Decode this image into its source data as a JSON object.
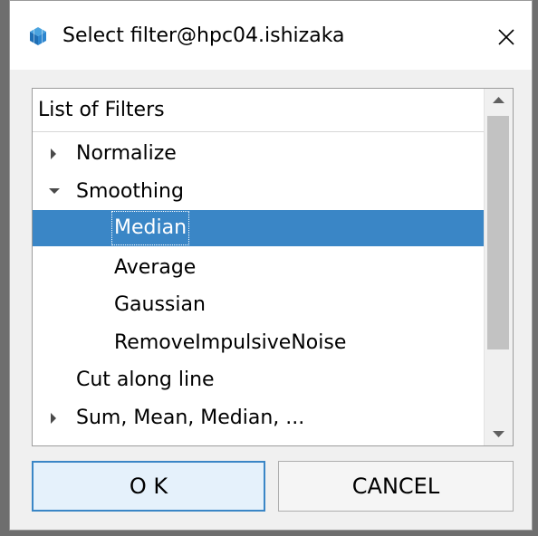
{
  "window": {
    "title": "Select filter@hpc04.ishizaka",
    "app_icon": "cube-icon",
    "close_icon": "close-icon"
  },
  "list": {
    "header": "List of Filters",
    "items": [
      {
        "label": "Normalize",
        "expander": "collapsed"
      },
      {
        "label": "Smoothing",
        "expander": "expanded"
      },
      {
        "label": "Median",
        "selected": true
      },
      {
        "label": "Average"
      },
      {
        "label": "Gaussian"
      },
      {
        "label": "RemoveImpulsiveNoise"
      },
      {
        "label": "Cut along line"
      },
      {
        "label": "Sum, Mean, Median, ...",
        "expander": "collapsed"
      }
    ]
  },
  "buttons": {
    "ok_label": "O K",
    "cancel_label": "CANCEL"
  },
  "colors": {
    "selection": "#3a86c6",
    "dialog_bg": "#f0f0f0",
    "titlebar_bg": "#ffffff"
  }
}
